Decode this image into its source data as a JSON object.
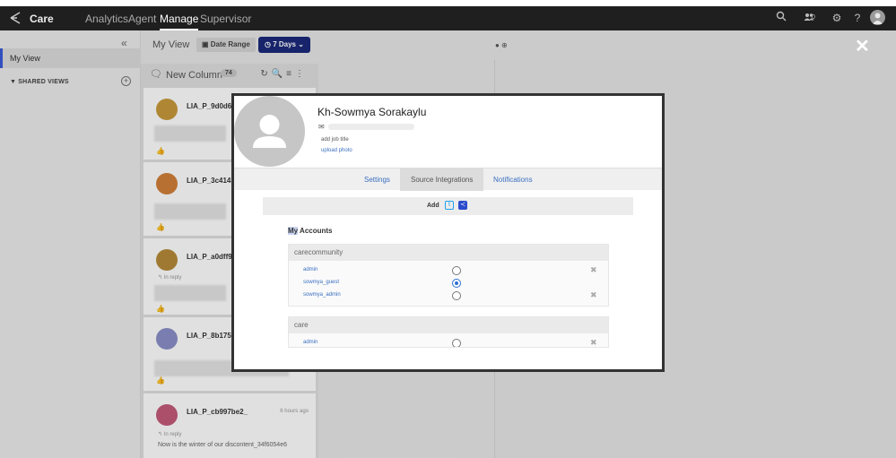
{
  "topbar": {
    "brand": "Care",
    "nav": [
      "Analytics",
      "Agent",
      "Manage",
      "Supervisor"
    ],
    "active_nav": "Manage",
    "users_count": "0"
  },
  "sidebar": {
    "my_view": "My View",
    "shared_views": "SHARED VIEWS"
  },
  "main": {
    "title": "My View",
    "date_range_label": "Date Range",
    "days_label": "7 Days"
  },
  "column": {
    "title": "New Column",
    "count": "74",
    "cards": [
      {
        "name": "LIA_P_9d0d65",
        "time": "",
        "reply": "",
        "text": ""
      },
      {
        "name": "LIA_P_3c4143",
        "time": "",
        "reply": "",
        "text": ""
      },
      {
        "name": "LIA_P_a0dff97",
        "time": "",
        "reply": "In reply",
        "text": ""
      },
      {
        "name": "LIA_P_8b1751",
        "time": "",
        "reply": "",
        "text": ""
      },
      {
        "name": "LIA_P_cb997be2_",
        "time": "6 hours ago",
        "reply": "In reply",
        "text": "Now is the winter of our discontent_34f6054e6"
      }
    ]
  },
  "modal": {
    "name": "Kh-Sowmya Sorakaylu",
    "add_job_title": "add job title",
    "upload_photo": "upload photo",
    "tabs": [
      "Settings",
      "Source Integrations",
      "Notifications"
    ],
    "active_tab": "Source Integrations",
    "add_label": "Add",
    "my_accounts_hl": "My",
    "my_accounts_rest": " Accounts",
    "groups": [
      {
        "name": "carecommunity",
        "accounts": [
          {
            "name": "admin",
            "selected": false,
            "deletable": true
          },
          {
            "name": "sowmya_guest",
            "selected": true,
            "deletable": false
          },
          {
            "name": "sowmya_admin",
            "selected": false,
            "deletable": true
          }
        ]
      },
      {
        "name": "care",
        "accounts": [
          {
            "name": "admin",
            "selected": false,
            "deletable": true
          }
        ]
      }
    ]
  },
  "colors": {
    "topbar": "#1f1f1f",
    "accent_blue": "#1b2a7a",
    "link_blue": "#3a6fc0"
  }
}
